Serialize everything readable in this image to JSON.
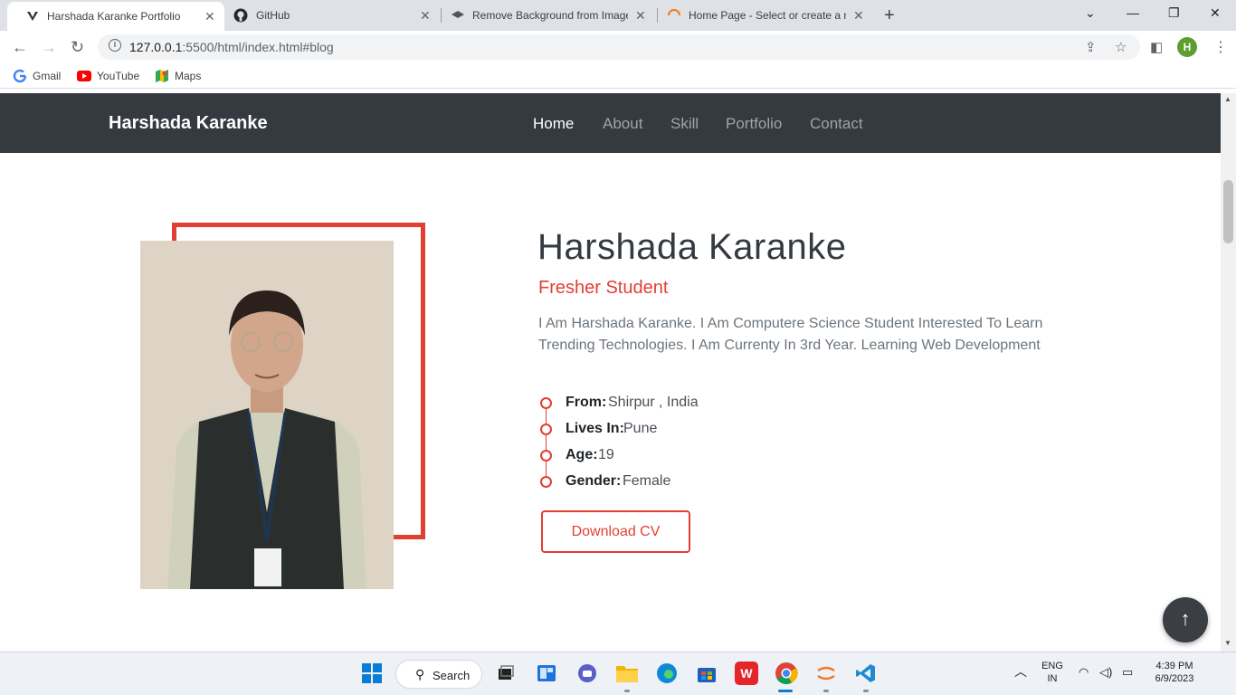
{
  "browser": {
    "tabs": [
      {
        "title": "Harshada Karanke Portfolio",
        "icon": "v-logo-icon",
        "active": true
      },
      {
        "title": "GitHub",
        "icon": "github-icon",
        "active": false
      },
      {
        "title": "Remove Background from Image",
        "icon": "layers-icon",
        "active": false
      },
      {
        "title": "Home Page - Select or create a n",
        "icon": "loading-icon",
        "active": false
      }
    ],
    "url_host": "127.0.0.1",
    "url_path": ":5500/html/index.html#blog",
    "avatar_letter": "H",
    "bookmarks": [
      {
        "label": "Gmail",
        "icon": "google-icon"
      },
      {
        "label": "YouTube",
        "icon": "youtube-icon"
      },
      {
        "label": "Maps",
        "icon": "maps-icon"
      }
    ]
  },
  "site": {
    "brand": "Harshada Karanke",
    "nav": [
      "Home",
      "About",
      "Skill",
      "Portfolio",
      "Contact"
    ],
    "active_nav": "Home",
    "about": {
      "name": "Harshada Karanke",
      "role": "Fresher Student",
      "description": "I Am Harshada Karanke. I Am Computere Science Student Interested To Learn Trending Technologies. I Am Currenty In 3rd Year. Learning Web Development",
      "info": [
        {
          "key": "From:",
          "value": "Shirpur , India"
        },
        {
          "key": "Lives In:",
          "value": "Pune"
        },
        {
          "key": "Age:",
          "value": "19"
        },
        {
          "key": "Gender:",
          "value": "Female"
        }
      ],
      "cv_button": "Download CV"
    },
    "accent": "#e23f33",
    "nav_bg": "#343a40"
  },
  "taskbar": {
    "search_label": "Search",
    "lang_top": "ENG",
    "lang_bottom": "IN",
    "time": "4:39 PM",
    "date": "6/9/2023"
  }
}
